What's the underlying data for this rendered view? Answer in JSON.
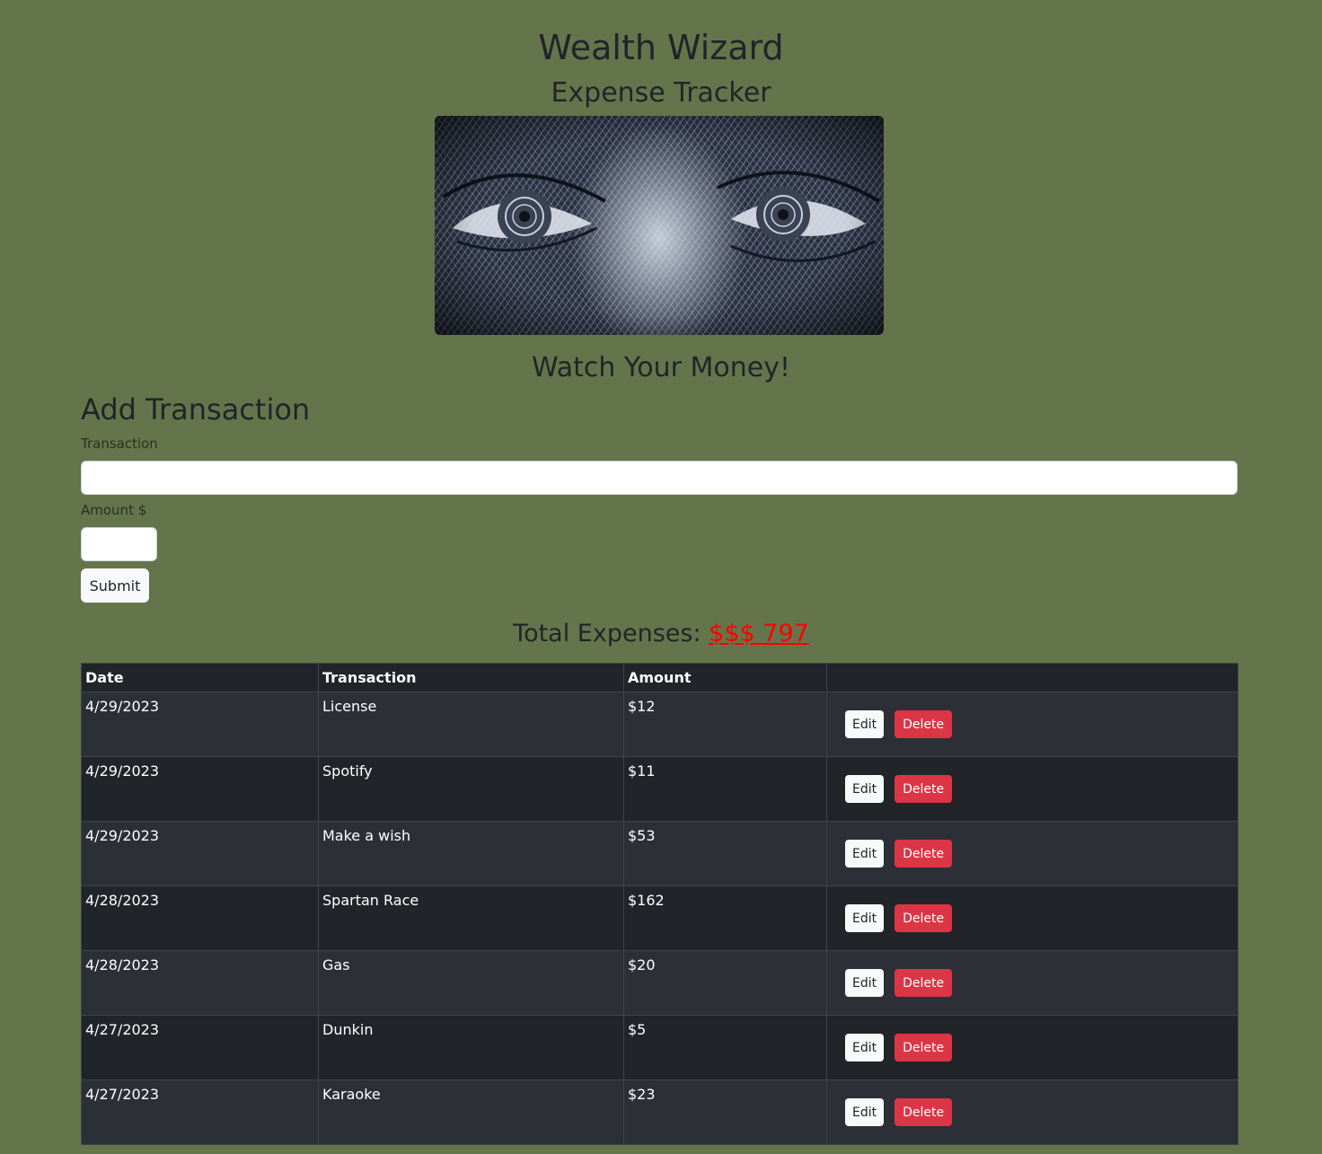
{
  "header": {
    "title": "Wealth Wizard",
    "subtitle": "Expense Tracker",
    "tagline": "Watch Your Money!"
  },
  "hero_image": {
    "description": "engraved eyes on currency"
  },
  "form": {
    "title": "Add Transaction",
    "transaction_label": "Transaction",
    "transaction_value": "",
    "amount_label": "Amount $",
    "amount_value": "",
    "submit_label": "Submit"
  },
  "total": {
    "label": "Total Expenses:",
    "value": "$$$ 797"
  },
  "table": {
    "headers": [
      "Date",
      "Transaction",
      "Amount",
      ""
    ],
    "edit_label": "Edit",
    "delete_label": "Delete",
    "rows": [
      {
        "date": "4/29/2023",
        "transaction": "License",
        "amount": "$12"
      },
      {
        "date": "4/29/2023",
        "transaction": "Spotify",
        "amount": "$11"
      },
      {
        "date": "4/29/2023",
        "transaction": "Make a wish",
        "amount": "$53"
      },
      {
        "date": "4/28/2023",
        "transaction": "Spartan Race",
        "amount": "$162"
      },
      {
        "date": "4/28/2023",
        "transaction": "Gas",
        "amount": "$20"
      },
      {
        "date": "4/27/2023",
        "transaction": "Dunkin",
        "amount": "$5"
      },
      {
        "date": "4/27/2023",
        "transaction": "Karaoke",
        "amount": "$23"
      }
    ]
  },
  "colors": {
    "background": "#65754b",
    "table_dark": "#212529",
    "table_stripe": "#2c3036",
    "delete": "#dc3545",
    "total_value": "#ff0000"
  }
}
